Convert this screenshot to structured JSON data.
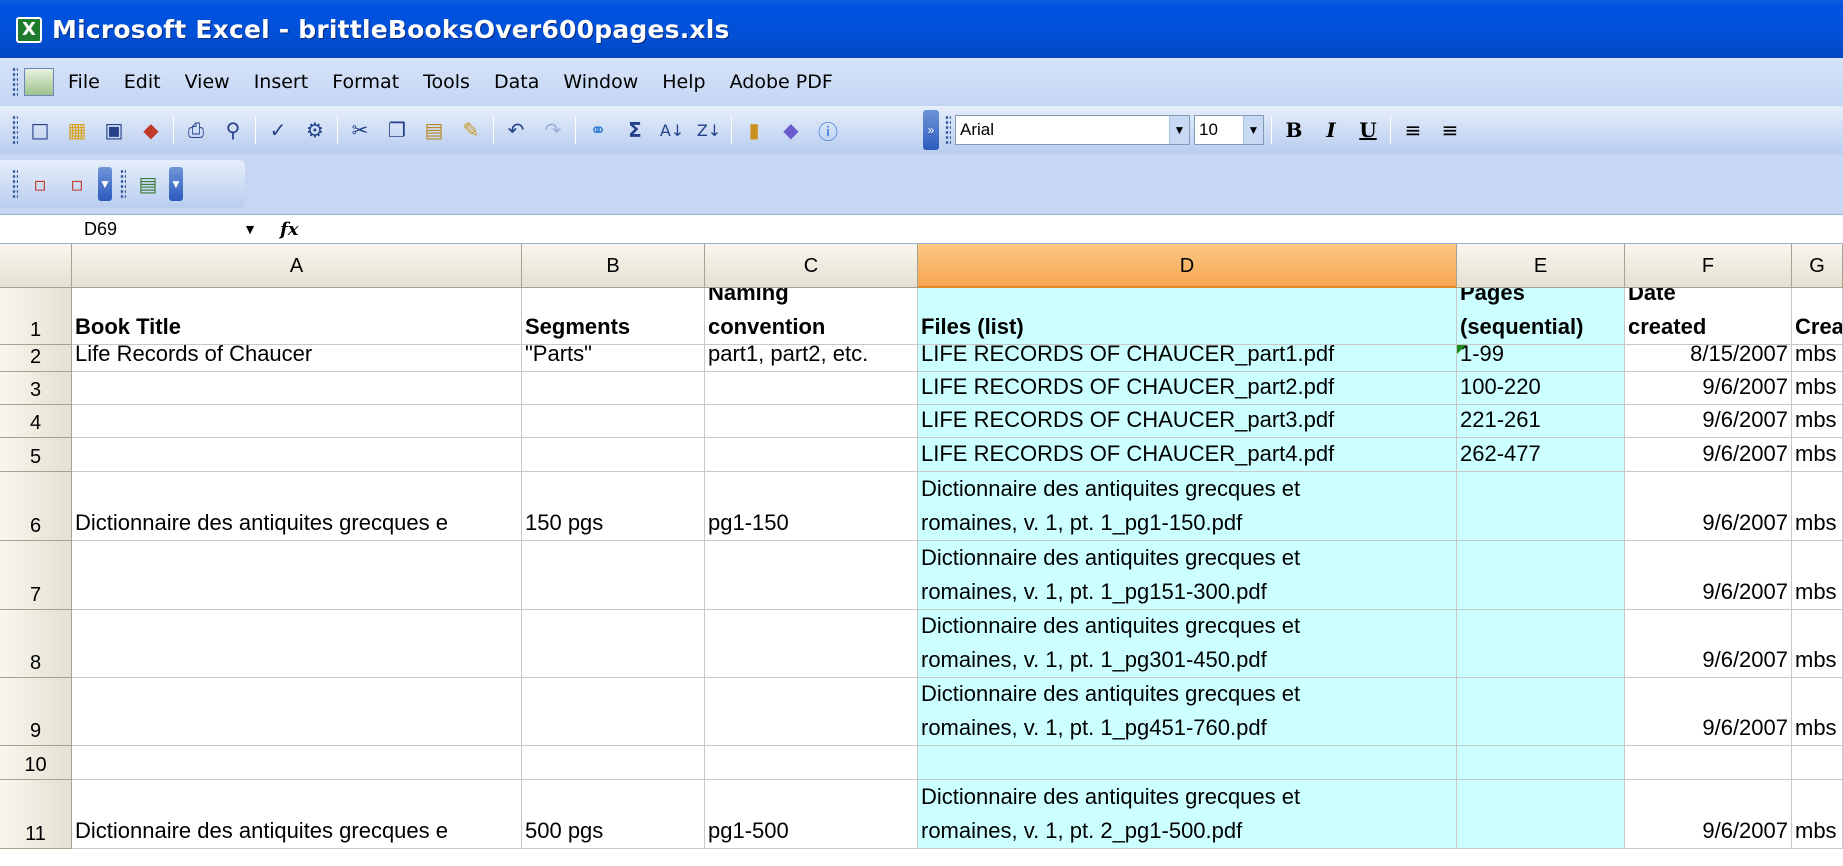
{
  "window": {
    "title": "Microsoft Excel - brittleBooksOver600pages.xls"
  },
  "menu": [
    "File",
    "Edit",
    "View",
    "Insert",
    "Format",
    "Tools",
    "Data",
    "Window",
    "Help",
    "Adobe PDF"
  ],
  "toolbar": {
    "font_name": "Arial",
    "font_size": "10",
    "bold_label": "B",
    "italic_label": "I",
    "underline_label": "U"
  },
  "formula_bar": {
    "name_box": "D69",
    "fx_label": "fx",
    "formula": ""
  },
  "sheet": {
    "columns": [
      "A",
      "B",
      "C",
      "D",
      "E",
      "F",
      "G"
    ],
    "selected_column": "D",
    "row_numbers": [
      "1",
      "2",
      "3",
      "4",
      "5",
      "6",
      "7",
      "8",
      "9",
      "10",
      "11"
    ],
    "headers": {
      "A": [
        "Book Title"
      ],
      "B": [
        "Segments"
      ],
      "C": [
        "Naming",
        "convention"
      ],
      "D": [
        "Files (list)"
      ],
      "E": [
        "Pages",
        "(sequential)"
      ],
      "F": [
        "Date",
        "created"
      ],
      "G": [
        "Creat"
      ]
    },
    "rows": [
      {
        "A": "Life Records of Chaucer",
        "B": "\"Parts\"",
        "C": "part1, part2, etc.",
        "D": [
          "LIFE RECORDS OF CHAUCER_part1.pdf"
        ],
        "E": "1-99",
        "F": "8/15/2007",
        "G": "mbs"
      },
      {
        "A": "",
        "B": "",
        "C": "",
        "D": [
          "LIFE RECORDS OF CHAUCER_part2.pdf"
        ],
        "E": "100-220",
        "F": "9/6/2007",
        "G": "mbs"
      },
      {
        "A": "",
        "B": "",
        "C": "",
        "D": [
          "LIFE RECORDS OF CHAUCER_part3.pdf"
        ],
        "E": "221-261",
        "F": "9/6/2007",
        "G": "mbs"
      },
      {
        "A": "",
        "B": "",
        "C": "",
        "D": [
          "LIFE RECORDS OF CHAUCER_part4.pdf"
        ],
        "E": "262-477",
        "F": "9/6/2007",
        "G": "mbs"
      },
      {
        "A": "Dictionnaire des antiquites grecques e",
        "B": "150 pgs",
        "C": "pg1-150",
        "D": [
          "Dictionnaire des antiquites grecques et",
          "romaines, v. 1, pt. 1_pg1-150.pdf"
        ],
        "E": "",
        "F": "9/6/2007",
        "G": "mbs"
      },
      {
        "A": "",
        "B": "",
        "C": "",
        "D": [
          "Dictionnaire des antiquites grecques et",
          "romaines, v. 1, pt. 1_pg151-300.pdf"
        ],
        "E": "",
        "F": "9/6/2007",
        "G": "mbs"
      },
      {
        "A": "",
        "B": "",
        "C": "",
        "D": [
          "Dictionnaire des antiquites grecques et",
          "romaines, v. 1, pt. 1_pg301-450.pdf"
        ],
        "E": "",
        "F": "9/6/2007",
        "G": "mbs"
      },
      {
        "A": "",
        "B": "",
        "C": "",
        "D": [
          "Dictionnaire des antiquites grecques et",
          "romaines, v. 1, pt. 1_pg451-760.pdf"
        ],
        "E": "",
        "F": "9/6/2007",
        "G": "mbs"
      },
      {
        "A": "",
        "B": "",
        "C": "",
        "D": [
          ""
        ],
        "E": "",
        "F": "",
        "G": ""
      },
      {
        "A": "Dictionnaire des antiquites grecques e",
        "B": "500 pgs",
        "C": "pg1-500",
        "D": [
          "Dictionnaire des antiquites grecques et",
          "romaines, v. 1, pt. 2_pg1-500.pdf"
        ],
        "E": "",
        "F": "9/6/2007",
        "G": "mbs"
      }
    ]
  },
  "colors": {
    "cyan_highlight": "#ccffff",
    "selected_header": "#f7a552",
    "title_bar": "#0054e3"
  }
}
